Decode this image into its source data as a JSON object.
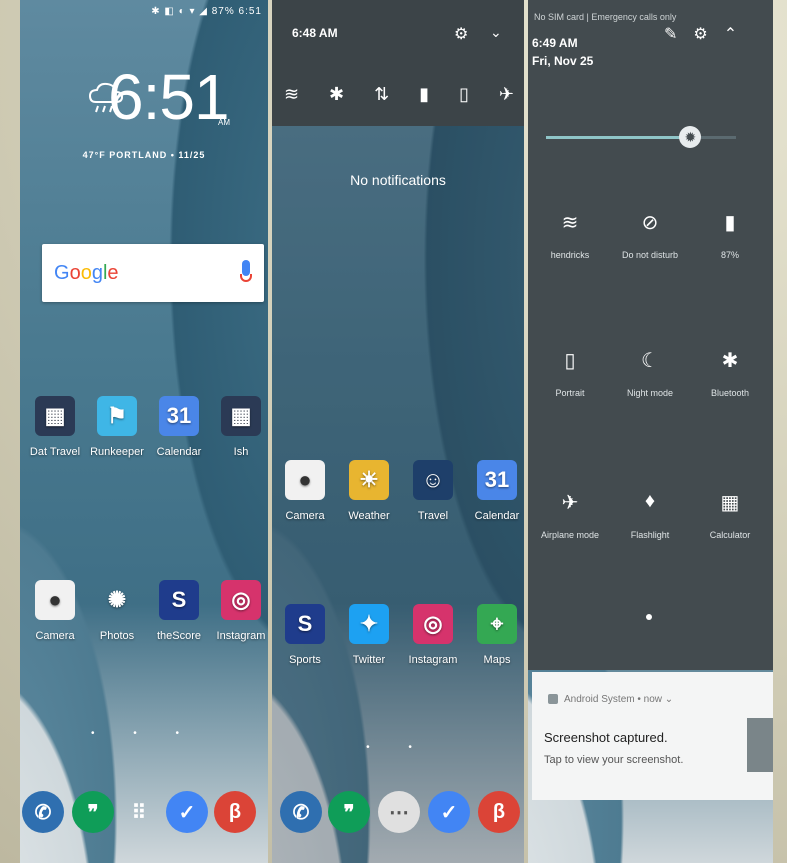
{
  "panel1": {
    "status_text": "✱ ◧ ◐ ▾ ◢ 87% 6:51",
    "clock": "6:51",
    "ampm": "AM",
    "weather_line": "47°F PORTLAND • 11/25",
    "search_logo": "Google",
    "apps_row1": [
      {
        "label": "Dat Travel",
        "icon": "folder-icon",
        "color": "#2b3a55",
        "glyph": "▦"
      },
      {
        "label": "Runkeeper",
        "icon": "runkeeper-icon",
        "color": "#3fb6e6",
        "glyph": "⚑"
      },
      {
        "label": "Calendar",
        "icon": "calendar-icon",
        "color": "#4a86e8",
        "glyph": "31"
      },
      {
        "label": "Ish",
        "icon": "folder-icon",
        "color": "#2b3a55",
        "glyph": "▦"
      }
    ],
    "apps_row2": [
      {
        "label": "Camera",
        "icon": "camera-icon",
        "color": "#f1f1f1",
        "glyph": "●"
      },
      {
        "label": "Photos",
        "icon": "photos-icon",
        "color": "transparent",
        "glyph": "✺"
      },
      {
        "label": "theScore",
        "icon": "thescore-icon",
        "color": "#1f3c8c",
        "glyph": "S"
      },
      {
        "label": "Instagram",
        "icon": "instagram-icon",
        "color": "#d6336c",
        "glyph": "◎"
      }
    ],
    "dock": [
      {
        "icon": "phone-icon",
        "color": "#2f6fb0",
        "glyph": "✆"
      },
      {
        "icon": "hangouts-icon",
        "color": "#0f9d58",
        "glyph": "❞"
      },
      {
        "icon": "app-drawer-icon",
        "color": "transparent",
        "glyph": "⠿"
      },
      {
        "icon": "inbox-icon",
        "color": "#4285f4",
        "glyph": "✓"
      },
      {
        "icon": "chrome-beta-icon",
        "color": "#db4437",
        "glyph": "β"
      }
    ]
  },
  "panel2": {
    "time": "6:48 AM",
    "qs_icons": [
      "wifi-icon",
      "bluetooth-icon",
      "data-icon",
      "battery-icon",
      "phone-portrait-icon",
      "airplane-icon"
    ],
    "qs_glyphs": [
      "≋",
      "✱",
      "⇅",
      "▮",
      "▯",
      "✈"
    ],
    "no_notifications": "No notifications",
    "apps_row1": [
      {
        "label": "Camera",
        "icon": "camera-icon",
        "color": "#f1f1f1",
        "glyph": "●"
      },
      {
        "label": "Weather",
        "icon": "weather-icon",
        "color": "#e8b530",
        "glyph": "☀"
      },
      {
        "label": "Travel",
        "icon": "travel-icon",
        "color": "#1e3f6a",
        "glyph": "☺"
      },
      {
        "label": "Calendar",
        "icon": "calendar-icon",
        "color": "#4a86e8",
        "glyph": "31"
      }
    ],
    "apps_row2": [
      {
        "label": "Sports",
        "icon": "sports-icon",
        "color": "#1f3c8c",
        "glyph": "S"
      },
      {
        "label": "Twitter",
        "icon": "twitter-icon",
        "color": "#1da1f2",
        "glyph": "✦"
      },
      {
        "label": "Instagram",
        "icon": "instagram-icon",
        "color": "#d6336c",
        "glyph": "◎"
      },
      {
        "label": "Maps",
        "icon": "maps-icon",
        "color": "#34a853",
        "glyph": "⌖"
      }
    ],
    "dock": [
      {
        "icon": "phone-icon",
        "color": "#2f6fb0",
        "glyph": "✆"
      },
      {
        "icon": "hangouts-icon",
        "color": "#0f9d58",
        "glyph": "❞"
      },
      {
        "icon": "app-drawer-icon",
        "color": "#e0e0e0",
        "glyph": "⋯"
      },
      {
        "icon": "inbox-icon",
        "color": "#4285f4",
        "glyph": "✓"
      },
      {
        "icon": "chrome-beta-icon",
        "color": "#db4437",
        "glyph": "β"
      }
    ]
  },
  "panel3": {
    "sim_status": "No SIM card | Emergency calls only",
    "time": "6:49 AM",
    "date": "Fri, Nov 25",
    "brightness_level": 0.76,
    "tiles_row1": [
      {
        "label": "hendricks",
        "icon": "wifi-icon",
        "glyph": "≋"
      },
      {
        "label": "Do not disturb",
        "icon": "do-not-disturb-icon",
        "glyph": "⊘"
      },
      {
        "label": "87%",
        "icon": "battery-icon",
        "glyph": "▮"
      }
    ],
    "tiles_row2": [
      {
        "label": "Portrait",
        "icon": "portrait-icon",
        "glyph": "▯"
      },
      {
        "label": "Night mode",
        "icon": "night-mode-icon",
        "glyph": "☾"
      },
      {
        "label": "Bluetooth",
        "icon": "bluetooth-icon",
        "glyph": "✱"
      }
    ],
    "tiles_row3": [
      {
        "label": "Airplane mode",
        "icon": "airplane-icon",
        "glyph": "✈"
      },
      {
        "label": "Flashlight",
        "icon": "flashlight-icon",
        "glyph": "♦"
      },
      {
        "label": "Calculator",
        "icon": "calculator-icon",
        "glyph": "▦"
      }
    ],
    "notification": {
      "source": "Android System • now ⌄",
      "title": "Screenshot captured.",
      "body": "Tap to view your screenshot."
    }
  }
}
